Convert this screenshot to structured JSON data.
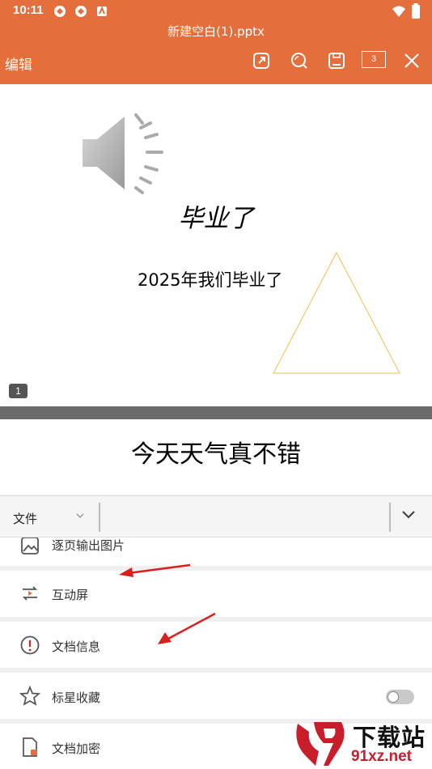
{
  "status": {
    "time": "10:11"
  },
  "header": {
    "file_name": "新建空白(1).pptx",
    "edit_label": "编辑",
    "page_count": "3"
  },
  "slide1": {
    "title": "毕业了",
    "subtitle": "2025年我们毕业了",
    "number": "1"
  },
  "slide2": {
    "title": "今天天气真不错"
  },
  "toolbar": {
    "tab_label": "文件"
  },
  "menu": {
    "items": [
      {
        "label": "逐页输出图片"
      },
      {
        "label": "互动屏"
      },
      {
        "label": "文档信息"
      },
      {
        "label": "标星收藏"
      },
      {
        "label": "文档加密"
      }
    ]
  },
  "watermark": {
    "text": "下载站",
    "url": "91xz.net"
  },
  "colors": {
    "header": "#e46e3c",
    "triangle": "#f0c050",
    "arrow": "#d8201c"
  }
}
